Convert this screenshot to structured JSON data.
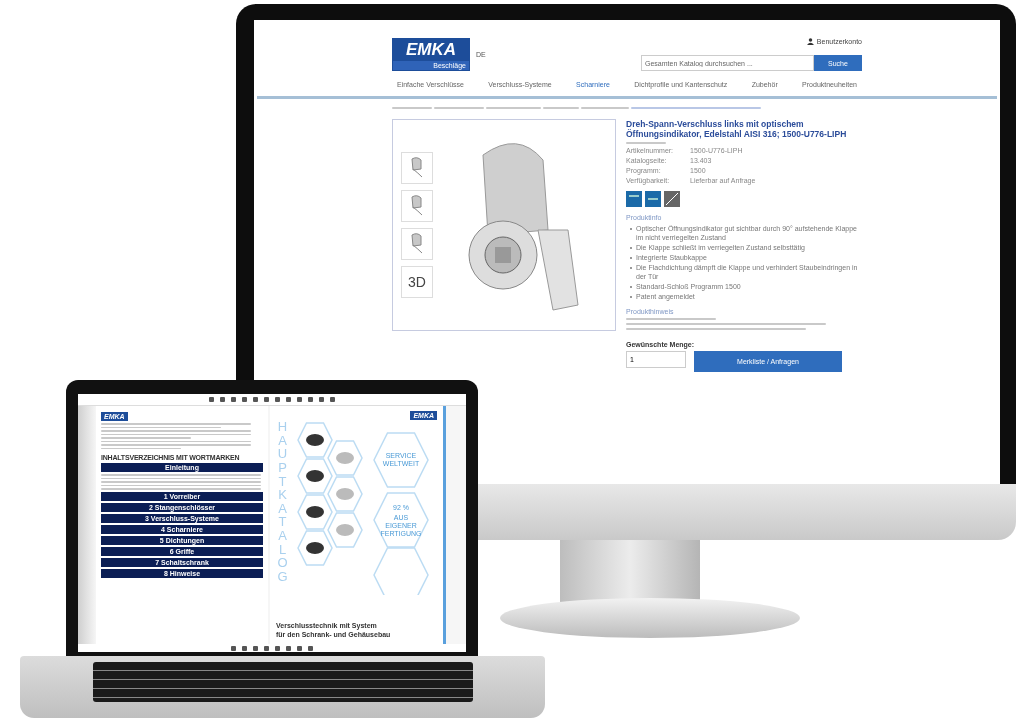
{
  "monitor": {
    "logo": {
      "wordmark": "EMKA",
      "tagline": "Beschläge"
    },
    "language": "DE",
    "account": "Benutzerkonto",
    "search": {
      "placeholder": "Gesamten Katalog durchsuchen ...",
      "button": "Suche"
    },
    "nav": [
      {
        "label": "Einfache Verschlüsse",
        "selected": false
      },
      {
        "label": "Verschluss-Systeme",
        "selected": false
      },
      {
        "label": "Scharniere",
        "selected": true
      },
      {
        "label": "Dichtprofile und Kantenschutz",
        "selected": false
      },
      {
        "label": "Zubehör",
        "selected": false
      },
      {
        "label": "Produktneuheiten",
        "selected": false
      }
    ],
    "product": {
      "title": "Dreh-Spann-Verschluss links mit optischem Öffnungsindikator, Edelstahl AISI 316; 1500-U776-LIPH",
      "thumb_3d": "3D",
      "specs": [
        {
          "label": "Artikelnummer:",
          "value": "1500-U776-LIPH"
        },
        {
          "label": "Katalogseite:",
          "value": "13.403"
        },
        {
          "label": "Programm:",
          "value": "1500"
        },
        {
          "label": "Verfügbarkeit:",
          "value": "Lieferbar auf Anfrage"
        }
      ],
      "info_heading": "Produktinfo",
      "bullets": [
        "Optischer Öffnungsindikator gut sichtbar durch 90° aufstehende Klappe im nicht verriegelten Zustand",
        "Die Klappe schließt im verriegelten Zustand selbsttätig",
        "Integrierte Staubkappe",
        "Die Flachdichtung dämpft die Klappe und verhindert Staubeindringen in der Tür",
        "Standard-Schloß Programm 1500",
        "Patent angemeldet"
      ],
      "hint_heading": "Produkthinweis",
      "quantity_label": "Gewünschte Menge:",
      "quantity": "1",
      "cart_button": "Merkliste / Anfragen"
    }
  },
  "laptop": {
    "left_page": {
      "logo": "EMKA",
      "toc_heading": "INHALTSVERZEICHNIS MIT WORTMARKEN",
      "intro": "Einleitung",
      "chapters": [
        "1 Vorreiber",
        "2 Stangenschlösser",
        "3 Verschluss-Systeme",
        "4 Scharniere",
        "5 Dichtungen",
        "6 Griffe",
        "7 Schaltschrank",
        "8 Hinweise"
      ]
    },
    "right_page": {
      "logo": "EMKA",
      "vertical_title": "HAUPTKATALOG",
      "badge_1": "SERVICE WELTWEIT",
      "badge_2_value": "92 %",
      "badge_2_text": "AUS EIGENER FERTIGUNG",
      "footer": [
        "Verschlusstechnik mit System",
        "für den Schrank- und Gehäusebau"
      ]
    }
  }
}
